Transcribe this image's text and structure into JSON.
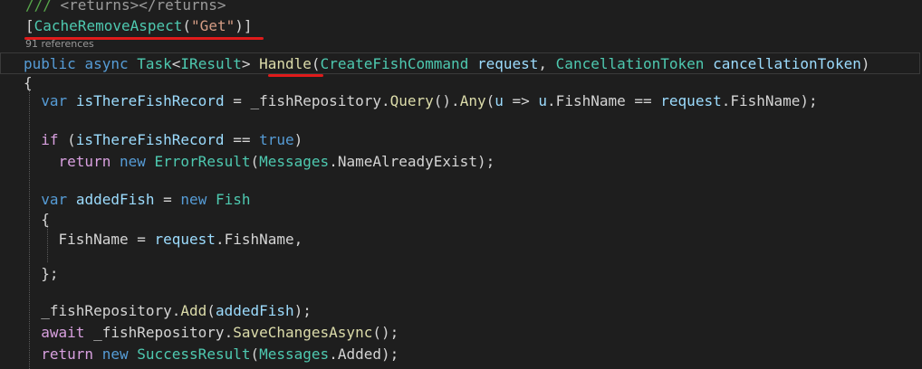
{
  "editor": {
    "lines": [
      [
        {
          "t": "/// ",
          "k": "comment"
        },
        {
          "t": "<returns></returns>",
          "k": "gray"
        }
      ],
      [
        {
          "t": "[",
          "k": "txt"
        },
        {
          "t": "CacheRemoveAspect",
          "k": "type"
        },
        {
          "t": "(",
          "k": "txt"
        },
        {
          "t": "\"Get\"",
          "k": "str"
        },
        {
          "t": ")]",
          "k": "txt"
        }
      ],
      [
        {
          "t": "public",
          "k": "kw"
        },
        {
          "t": " ",
          "k": "txt"
        },
        {
          "t": "async",
          "k": "kw"
        },
        {
          "t": " ",
          "k": "txt"
        },
        {
          "t": "Task",
          "k": "type"
        },
        {
          "t": "<",
          "k": "txt"
        },
        {
          "t": "IResult",
          "k": "type"
        },
        {
          "t": "> ",
          "k": "txt"
        },
        {
          "t": "Handle",
          "k": "method"
        },
        {
          "t": "(",
          "k": "txt"
        },
        {
          "t": "CreateFishCommand",
          "k": "type"
        },
        {
          "t": " ",
          "k": "txt"
        },
        {
          "t": "request",
          "k": "var"
        },
        {
          "t": ", ",
          "k": "txt"
        },
        {
          "t": "CancellationToken",
          "k": "type"
        },
        {
          "t": " ",
          "k": "txt"
        },
        {
          "t": "cancellationToken",
          "k": "var"
        },
        {
          "t": ")",
          "k": "txt"
        }
      ],
      [
        {
          "t": "{",
          "k": "txt"
        }
      ],
      [
        {
          "t": "  ",
          "k": "txt"
        },
        {
          "t": "var",
          "k": "kw"
        },
        {
          "t": " ",
          "k": "txt"
        },
        {
          "t": "isThereFishRecord",
          "k": "var"
        },
        {
          "t": " = _fishRepository.",
          "k": "txt"
        },
        {
          "t": "Query",
          "k": "method"
        },
        {
          "t": "().",
          "k": "txt"
        },
        {
          "t": "Any",
          "k": "method"
        },
        {
          "t": "(",
          "k": "txt"
        },
        {
          "t": "u",
          "k": "var"
        },
        {
          "t": " => ",
          "k": "txt"
        },
        {
          "t": "u",
          "k": "var"
        },
        {
          "t": ".FishName == ",
          "k": "txt"
        },
        {
          "t": "request",
          "k": "var"
        },
        {
          "t": ".FishName);",
          "k": "txt"
        }
      ],
      [],
      [
        {
          "t": "  ",
          "k": "txt"
        },
        {
          "t": "if",
          "k": "ctl"
        },
        {
          "t": " (",
          "k": "txt"
        },
        {
          "t": "isThereFishRecord",
          "k": "var"
        },
        {
          "t": " == ",
          "k": "txt"
        },
        {
          "t": "true",
          "k": "kw"
        },
        {
          "t": ")",
          "k": "txt"
        }
      ],
      [
        {
          "t": "    ",
          "k": "txt"
        },
        {
          "t": "return",
          "k": "ctl"
        },
        {
          "t": " ",
          "k": "txt"
        },
        {
          "t": "new",
          "k": "kw"
        },
        {
          "t": " ",
          "k": "txt"
        },
        {
          "t": "ErrorResult",
          "k": "type"
        },
        {
          "t": "(",
          "k": "txt"
        },
        {
          "t": "Messages",
          "k": "type"
        },
        {
          "t": ".NameAlreadyExist);",
          "k": "txt"
        }
      ],
      [],
      [
        {
          "t": "  ",
          "k": "txt"
        },
        {
          "t": "var",
          "k": "kw"
        },
        {
          "t": " ",
          "k": "txt"
        },
        {
          "t": "addedFish",
          "k": "var"
        },
        {
          "t": " = ",
          "k": "txt"
        },
        {
          "t": "new",
          "k": "kw"
        },
        {
          "t": " ",
          "k": "txt"
        },
        {
          "t": "Fish",
          "k": "type"
        }
      ],
      [
        {
          "t": "  {",
          "k": "txt"
        }
      ],
      [
        {
          "t": "    FishName = ",
          "k": "txt"
        },
        {
          "t": "request",
          "k": "var"
        },
        {
          "t": ".FishName,",
          "k": "txt"
        }
      ],
      [],
      [
        {
          "t": "  };",
          "k": "txt"
        }
      ],
      [],
      [
        {
          "t": "  _fishRepository.",
          "k": "txt"
        },
        {
          "t": "Add",
          "k": "method"
        },
        {
          "t": "(",
          "k": "txt"
        },
        {
          "t": "addedFish",
          "k": "var"
        },
        {
          "t": ");",
          "k": "txt"
        }
      ],
      [
        {
          "t": "  ",
          "k": "txt"
        },
        {
          "t": "await",
          "k": "ctl"
        },
        {
          "t": " _fishRepository.",
          "k": "txt"
        },
        {
          "t": "SaveChangesAsync",
          "k": "method"
        },
        {
          "t": "();",
          "k": "txt"
        }
      ],
      [
        {
          "t": "  ",
          "k": "txt"
        },
        {
          "t": "return",
          "k": "ctl"
        },
        {
          "t": " ",
          "k": "txt"
        },
        {
          "t": "new",
          "k": "kw"
        },
        {
          "t": " ",
          "k": "txt"
        },
        {
          "t": "SuccessResult",
          "k": "type"
        },
        {
          "t": "(",
          "k": "txt"
        },
        {
          "t": "Messages",
          "k": "type"
        },
        {
          "t": ".Added);",
          "k": "txt"
        }
      ]
    ],
    "codelens": "91 references"
  }
}
